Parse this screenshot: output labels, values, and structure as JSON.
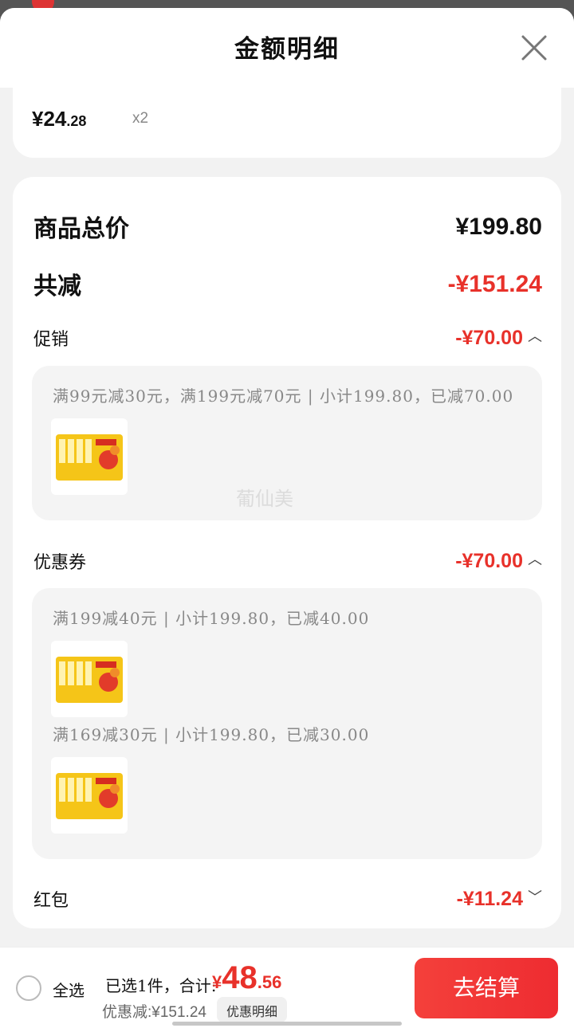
{
  "sheet": {
    "title": "金额明细"
  },
  "top_item": {
    "price_main": "¥24",
    "price_cents": ".28",
    "quantity": "x2"
  },
  "summary_card": {
    "total_label": "商品总价",
    "total_value": "¥199.80",
    "reduce_label": "共减",
    "reduce_value": "-¥151.24",
    "promotion": {
      "label": "促销",
      "value": "-¥70.00",
      "detail": "满99元减30元，满199元减70元 | 小计199.80，已减70.00"
    },
    "coupon": {
      "label": "优惠券",
      "value": "-¥70.00",
      "details": [
        "满199减40元 | 小计199.80，已减40.00",
        "满169减30元 | 小计199.80，已减30.00"
      ]
    },
    "red_packet": {
      "label": "红包",
      "value": "-¥11.24"
    },
    "watermark": "葡仙美"
  },
  "bottom_bar": {
    "select_all": "全选",
    "summary_prefix": "已选1件，合计:",
    "total_yen": "¥",
    "total_int": "48",
    "total_dec": ".56",
    "discount_text": "优惠减:¥151.24",
    "detail_button": "优惠明细",
    "checkout_button": "去结算"
  },
  "colors": {
    "accent_red": "#e8312a",
    "product_yellow": "#f5c518"
  }
}
